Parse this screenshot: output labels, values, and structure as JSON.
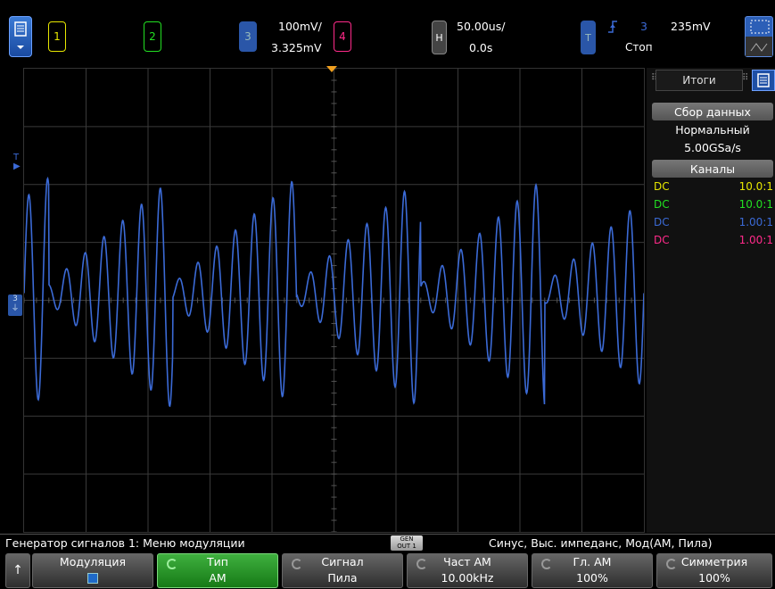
{
  "top": {
    "ch1": "1",
    "ch2": "2",
    "ch3": "3",
    "ch4": "4",
    "vscale": "100mV/",
    "voffset": "3.325mV",
    "h_label": "H",
    "tscale": "50.00us/",
    "tdelay": "0.0s",
    "trig_label": "T",
    "trig_src": "3",
    "trig_level": "235mV",
    "run_state": "Стоп",
    "colors": {
      "ch1": "#e8e800",
      "ch2": "#22e022",
      "ch3": "#3b6ad6",
      "ch4": "#ff2a8a"
    }
  },
  "panel": {
    "tab": "Итоги",
    "acq_head": "Сбор данных",
    "acq_mode": "Нормальный",
    "sample_rate": "5.00GSa/s",
    "chan_head": "Каналы",
    "channels": [
      {
        "coupling": "DC",
        "probe": "10.0:1",
        "color": "#e8e800"
      },
      {
        "coupling": "DC",
        "probe": "10.0:1",
        "color": "#22e022"
      },
      {
        "coupling": "DC",
        "probe": "1.00:1",
        "color": "#3b6ad6"
      },
      {
        "coupling": "DC",
        "probe": "1.00:1",
        "color": "#ff2a8a"
      }
    ]
  },
  "markers": {
    "trig_level_marker": "T",
    "ch3_marker": "3"
  },
  "status": {
    "left": "Генератор сигналов 1: Меню модуляции",
    "gen_line1": "GEN",
    "gen_line2": "OUT 1",
    "right": "Синус, Выс. импеданс, Мод(AM, Пила)"
  },
  "softkeys": {
    "back": "↑",
    "k1": {
      "label": "Модуляция",
      "value": ""
    },
    "k2": {
      "label": "Тип",
      "value": "AM"
    },
    "k3": {
      "label": "Сигнал",
      "value": "Пила"
    },
    "k4": {
      "label": "Част AM",
      "value": "10.00kHz"
    },
    "k5": {
      "label": "Гл. AM",
      "value": "100%"
    },
    "k6": {
      "label": "Симметрия",
      "value": "100%"
    }
  },
  "waveform": {
    "channel": "3",
    "carrier_cycles_per_div": 3.3,
    "mod_freq": "10.00kHz",
    "mod_depth_percent": 100,
    "mod_shape": "Пила"
  }
}
